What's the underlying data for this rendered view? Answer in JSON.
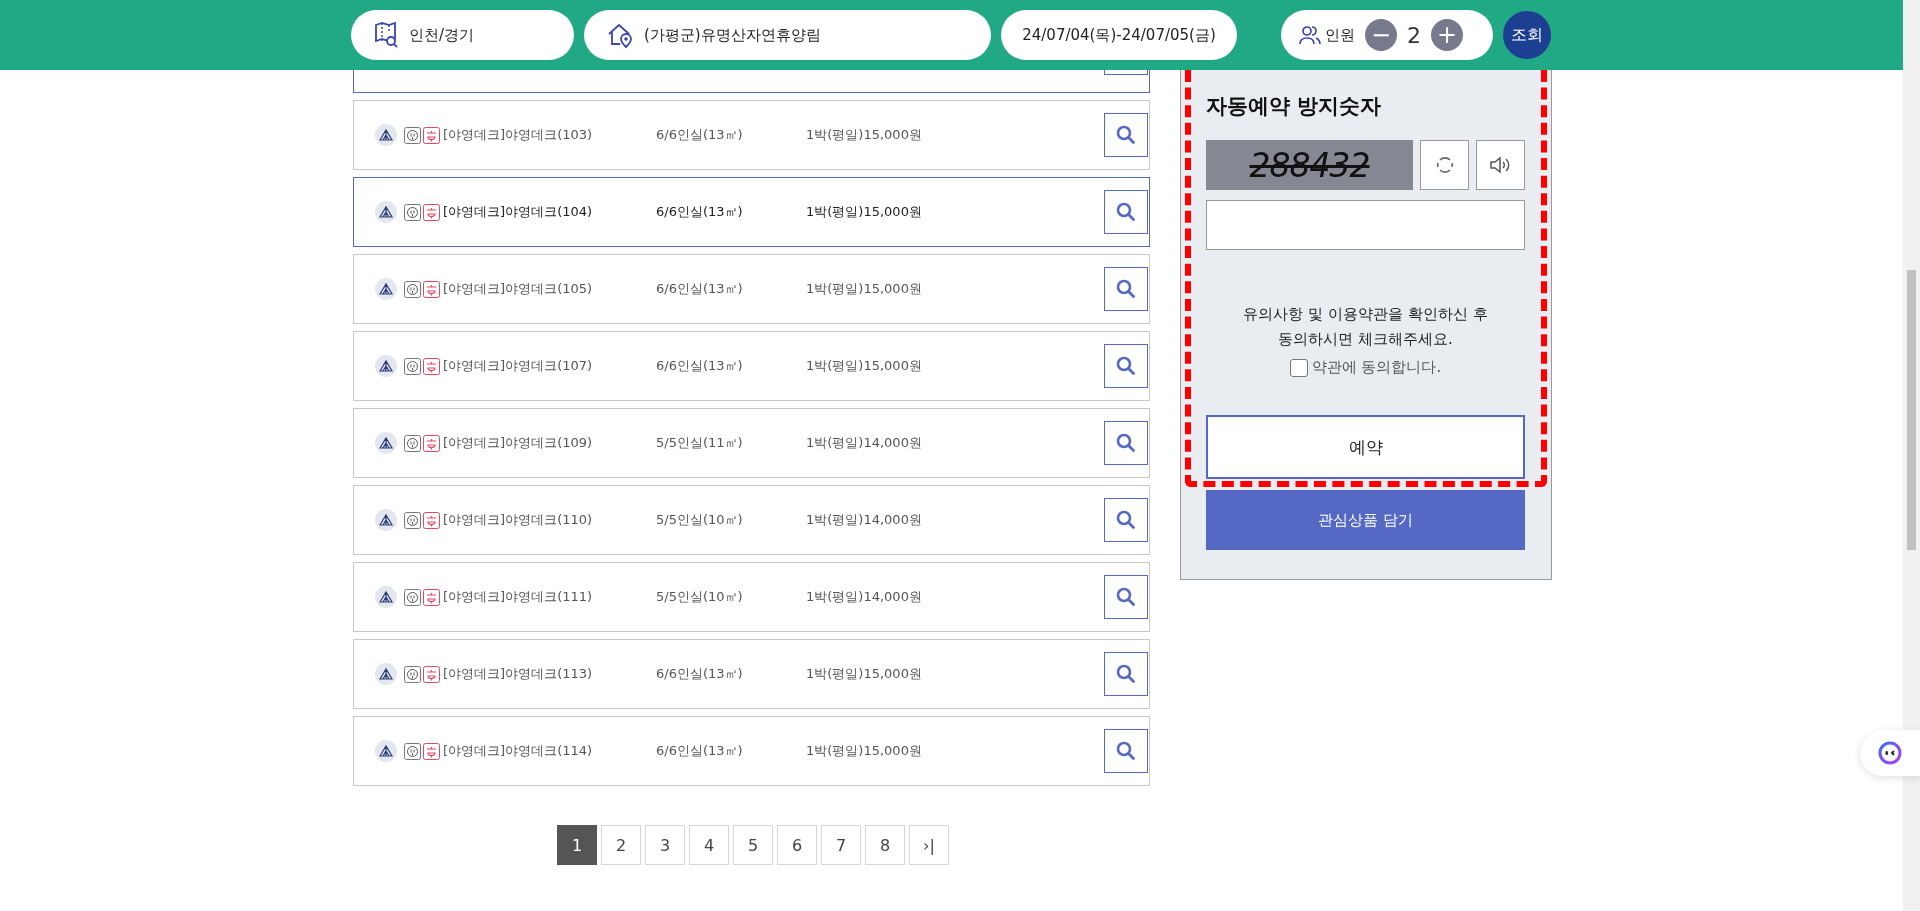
{
  "search_bar": {
    "region": "인천/경기",
    "site": "(가평군)유명산자연휴양림",
    "dates": "24/07/04(목)-24/07/05(금)",
    "people_label": "인원",
    "people_count": "2",
    "minus": "−",
    "plus": "+",
    "submit": "조회"
  },
  "rows": [
    {
      "kind": "clipped",
      "selected": true
    },
    {
      "kind": "full",
      "selected": false,
      "name": "[야영데크]야영데크(103)",
      "capacity": "6/6인실(13㎡)",
      "price": "1박(평일)15,000원"
    },
    {
      "kind": "full",
      "selected": true,
      "name": "[야영데크]야영데크(104)",
      "capacity": "6/6인실(13㎡)",
      "price": "1박(평일)15,000원"
    },
    {
      "kind": "full",
      "selected": false,
      "name": "[야영데크]야영데크(105)",
      "capacity": "6/6인실(13㎡)",
      "price": "1박(평일)15,000원"
    },
    {
      "kind": "full",
      "selected": false,
      "name": "[야영데크]야영데크(107)",
      "capacity": "6/6인실(13㎡)",
      "price": "1박(평일)15,000원"
    },
    {
      "kind": "full",
      "selected": false,
      "name": "[야영데크]야영데크(109)",
      "capacity": "5/5인실(11㎡)",
      "price": "1박(평일)14,000원"
    },
    {
      "kind": "full",
      "selected": false,
      "name": "[야영데크]야영데크(110)",
      "capacity": "5/5인실(10㎡)",
      "price": "1박(평일)14,000원"
    },
    {
      "kind": "full",
      "selected": false,
      "name": "[야영데크]야영데크(111)",
      "capacity": "5/5인실(10㎡)",
      "price": "1박(평일)14,000원"
    },
    {
      "kind": "full",
      "selected": false,
      "name": "[야영데크]야영데크(113)",
      "capacity": "6/6인실(13㎡)",
      "price": "1박(평일)15,000원"
    },
    {
      "kind": "full",
      "selected": false,
      "name": "[야영데크]야영데크(114)",
      "capacity": "6/6인실(13㎡)",
      "price": "1박(평일)15,000원"
    }
  ],
  "pagination": {
    "pages": [
      {
        "label": "1",
        "selected": true
      },
      {
        "label": "2",
        "selected": false
      },
      {
        "label": "3",
        "selected": false
      },
      {
        "label": "4",
        "selected": false
      },
      {
        "label": "5",
        "selected": false
      },
      {
        "label": "6",
        "selected": false
      },
      {
        "label": "7",
        "selected": false
      },
      {
        "label": "8",
        "selected": false
      }
    ],
    "last": "›|"
  },
  "booking_panel": {
    "title": "자동예약 방지숫자",
    "captcha": "288432",
    "notice": "유의사항 및 이용약관을 확인하신 후\n동의하시면 체크해주세요.",
    "agree_label": "약관에 동의합니다.",
    "agree_checked": false,
    "reserve_button": "예약",
    "wishlist_button": "관심상품 담기"
  }
}
